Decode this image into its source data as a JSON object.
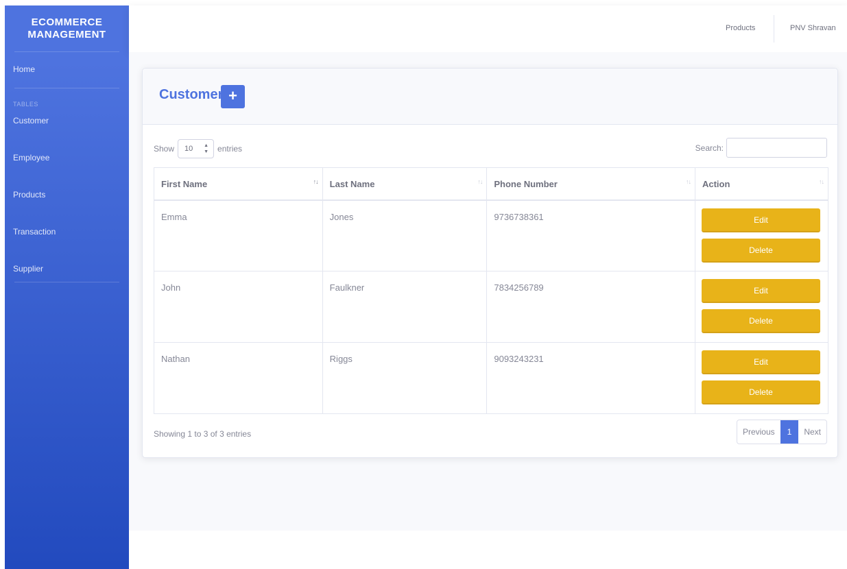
{
  "sidebar": {
    "brand_line1": "ECOMMERCE",
    "brand_line2": "MANAGEMENT",
    "home": "Home",
    "heading": "TABLES",
    "items": [
      {
        "label": "Customer"
      },
      {
        "label": "Employee"
      },
      {
        "label": "Products"
      },
      {
        "label": "Transaction"
      },
      {
        "label": "Supplier"
      }
    ]
  },
  "topbar": {
    "products": "Products",
    "user": "PNV Shravan"
  },
  "card": {
    "title": "Customer",
    "add_icon": "+"
  },
  "length": {
    "show": "Show",
    "value": "10",
    "entries": "entries"
  },
  "search": {
    "label": "Search:",
    "value": ""
  },
  "table": {
    "headers": [
      "First Name",
      "Last Name",
      "Phone Number",
      "Action"
    ],
    "sort_icon": "↑↓",
    "rows": [
      {
        "first": "Emma",
        "last": "Jones",
        "phone": "9736738361",
        "edit": "Edit",
        "delete": "Delete"
      },
      {
        "first": "John",
        "last": "Faulkner",
        "phone": "7834256789",
        "edit": "Edit",
        "delete": "Delete"
      },
      {
        "first": "Nathan",
        "last": "Riggs",
        "phone": "9093243231",
        "edit": "Edit",
        "delete": "Delete"
      }
    ]
  },
  "footer": {
    "info": "Showing 1 to 3 of 3 entries",
    "previous": "Previous",
    "page": "1",
    "next": "Next"
  },
  "colors": {
    "primary": "#4e73df",
    "warning": "#e8b319"
  }
}
